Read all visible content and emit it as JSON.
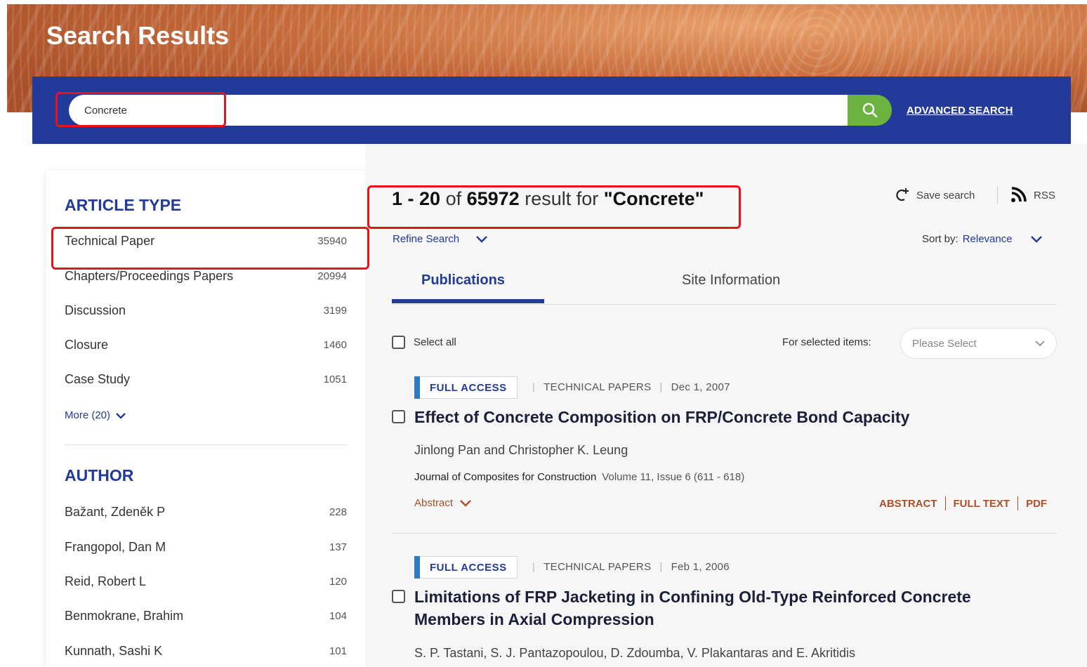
{
  "header": {
    "title": "Search Results"
  },
  "search": {
    "value": "Concrete",
    "advanced_label": "ADVANCED SEARCH"
  },
  "sidebar": {
    "article_type": {
      "heading": "ARTICLE TYPE",
      "items": [
        {
          "label": "Technical Paper",
          "count": "35940"
        },
        {
          "label": "Chapters/Proceedings Papers",
          "count": "20994"
        },
        {
          "label": "Discussion",
          "count": "3199"
        },
        {
          "label": "Closure",
          "count": "1460"
        },
        {
          "label": "Case Study",
          "count": "1051"
        }
      ],
      "more_label": "More (20)"
    },
    "author": {
      "heading": "AUTHOR",
      "items": [
        {
          "label": "Bažant, Zdeněk P",
          "count": "228"
        },
        {
          "label": "Frangopol, Dan M",
          "count": "137"
        },
        {
          "label": "Reid, Robert L",
          "count": "120"
        },
        {
          "label": "Benmokrane, Brahim",
          "count": "104"
        },
        {
          "label": "Kunnath, Sashi K",
          "count": "101"
        }
      ]
    }
  },
  "results": {
    "range": "1 - 20",
    "of": "of",
    "total": "65972",
    "result_for": "result for",
    "query": "\"Concrete\"",
    "save_search": "Save search",
    "rss": "RSS",
    "refine": "Refine Search",
    "sort_label": "Sort by:",
    "sort_value": "Relevance",
    "tabs": [
      "Publications",
      "Site Information"
    ],
    "select_all": "Select all",
    "for_selected": "For selected items:",
    "select_placeholder": "Please Select",
    "items": [
      {
        "access": "FULL ACCESS",
        "type": "TECHNICAL PAPERS",
        "date": "Dec 1, 2007",
        "title": "Effect of Concrete Composition on FRP/Concrete Bond Capacity",
        "authors": "Jinlong Pan and Christopher K. Leung",
        "journal": "Journal of Composites for Construction",
        "volume": "Volume 11, Issue 6 (611 - 618)",
        "abstract_toggle": "Abstract",
        "links": [
          "ABSTRACT",
          "FULL TEXT",
          "PDF"
        ]
      },
      {
        "access": "FULL ACCESS",
        "type": "TECHNICAL PAPERS",
        "date": "Feb 1, 2006",
        "title": "Limitations of FRP Jacketing in Confining Old-Type Reinforced Concrete Members in Axial Compression",
        "authors": "S. P. Tastani, S. J. Pantazopoulou, D. Zdoumba, V. Plakantaras and E. Akritidis"
      }
    ]
  },
  "colors": {
    "brand_blue": "#223a9a",
    "search_green": "#6cb33f",
    "accent_rust": "#a8512a",
    "highlight_red": "#e8121b"
  }
}
